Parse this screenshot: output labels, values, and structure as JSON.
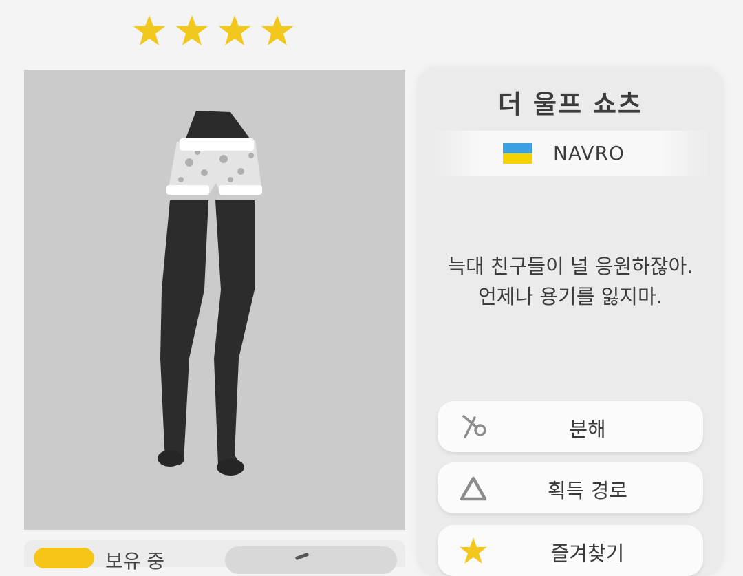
{
  "rating": {
    "stars": 4,
    "star_color": "#f3c81e"
  },
  "item": {
    "title": "더 울프 쇼츠",
    "brand": "NAVRO",
    "brand_flag_colors": [
      "#3aa0e0",
      "#f6d300"
    ],
    "description_line1": "늑대 친구들이 널 응원하잖아.",
    "description_line2": "언제나 용기를 잃지마."
  },
  "actions": {
    "disassemble": {
      "label": "분해",
      "icon": "scissors-icon"
    },
    "obtain_path": {
      "label": "획득 경로",
      "icon": "triangle-icon"
    },
    "favorite": {
      "label": "즐겨찾기",
      "icon": "star-icon"
    }
  },
  "bottom": {
    "owned_label": "보유 중"
  }
}
